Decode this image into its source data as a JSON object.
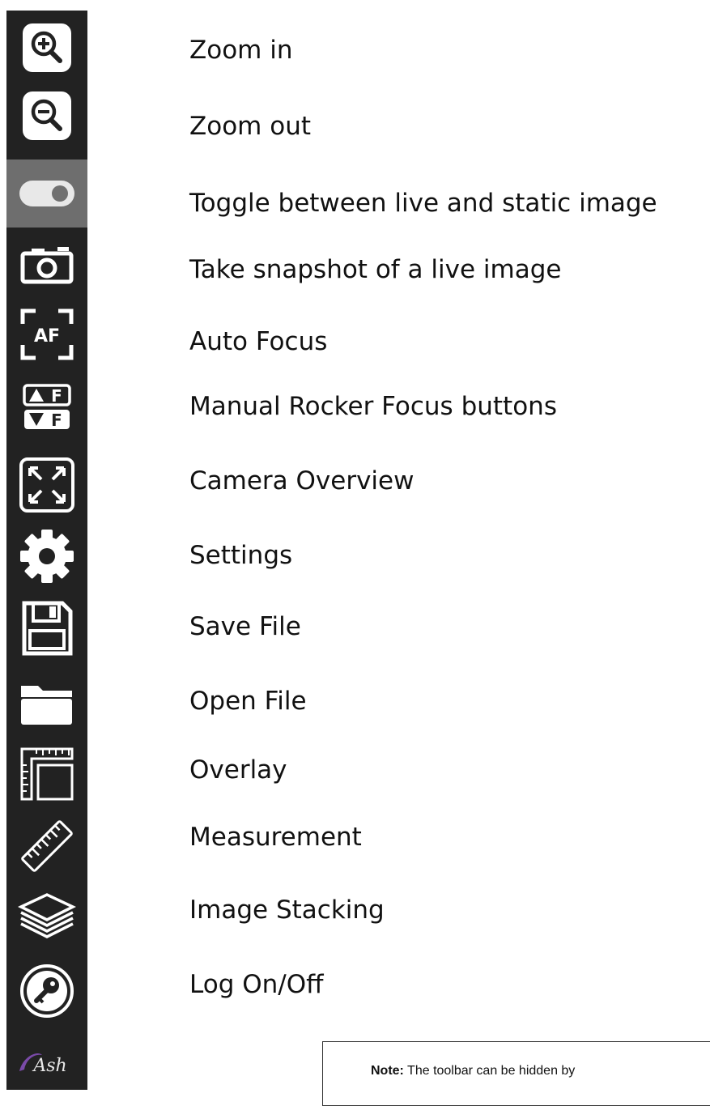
{
  "toolbar": {
    "tools": [
      {
        "name": "zoom-in",
        "icon": "zoom-in-icon",
        "label": "Zoom in"
      },
      {
        "name": "zoom-out",
        "icon": "zoom-out-icon",
        "label": "Zoom out"
      },
      {
        "name": "live-static-toggle",
        "icon": "toggle-icon",
        "label": "Toggle between live and static image",
        "active": true
      },
      {
        "name": "snapshot",
        "icon": "camera-icon",
        "label": "Take snapshot of a live image"
      },
      {
        "name": "auto-focus",
        "icon": "auto-focus-icon",
        "label": "Auto Focus"
      },
      {
        "name": "manual-focus",
        "icon": "focus-rocker-icon",
        "label": "Manual Rocker Focus buttons"
      },
      {
        "name": "camera-overview",
        "icon": "expand-icon",
        "label": "Camera Overview"
      },
      {
        "name": "settings",
        "icon": "gear-icon",
        "label": "Settings"
      },
      {
        "name": "save-file",
        "icon": "floppy-disk-icon",
        "label": "Save File"
      },
      {
        "name": "open-file",
        "icon": "folder-icon",
        "label": "Open File"
      },
      {
        "name": "overlay",
        "icon": "ruler-overlay-icon",
        "label": "Overlay"
      },
      {
        "name": "measurement",
        "icon": "ruler-icon",
        "label": "Measurement"
      },
      {
        "name": "image-stacking",
        "icon": "layers-icon",
        "label": "Image Stacking"
      },
      {
        "name": "log-on-off",
        "icon": "key-icon",
        "label": "Log On/Off"
      }
    ],
    "logo_text": "Ash",
    "colors": {
      "background": "#222222",
      "active_background": "#6e6e6e",
      "icon": "#ffffff"
    }
  },
  "note": {
    "prefix": "Note:",
    "text": " The toolbar can be hidden by"
  }
}
